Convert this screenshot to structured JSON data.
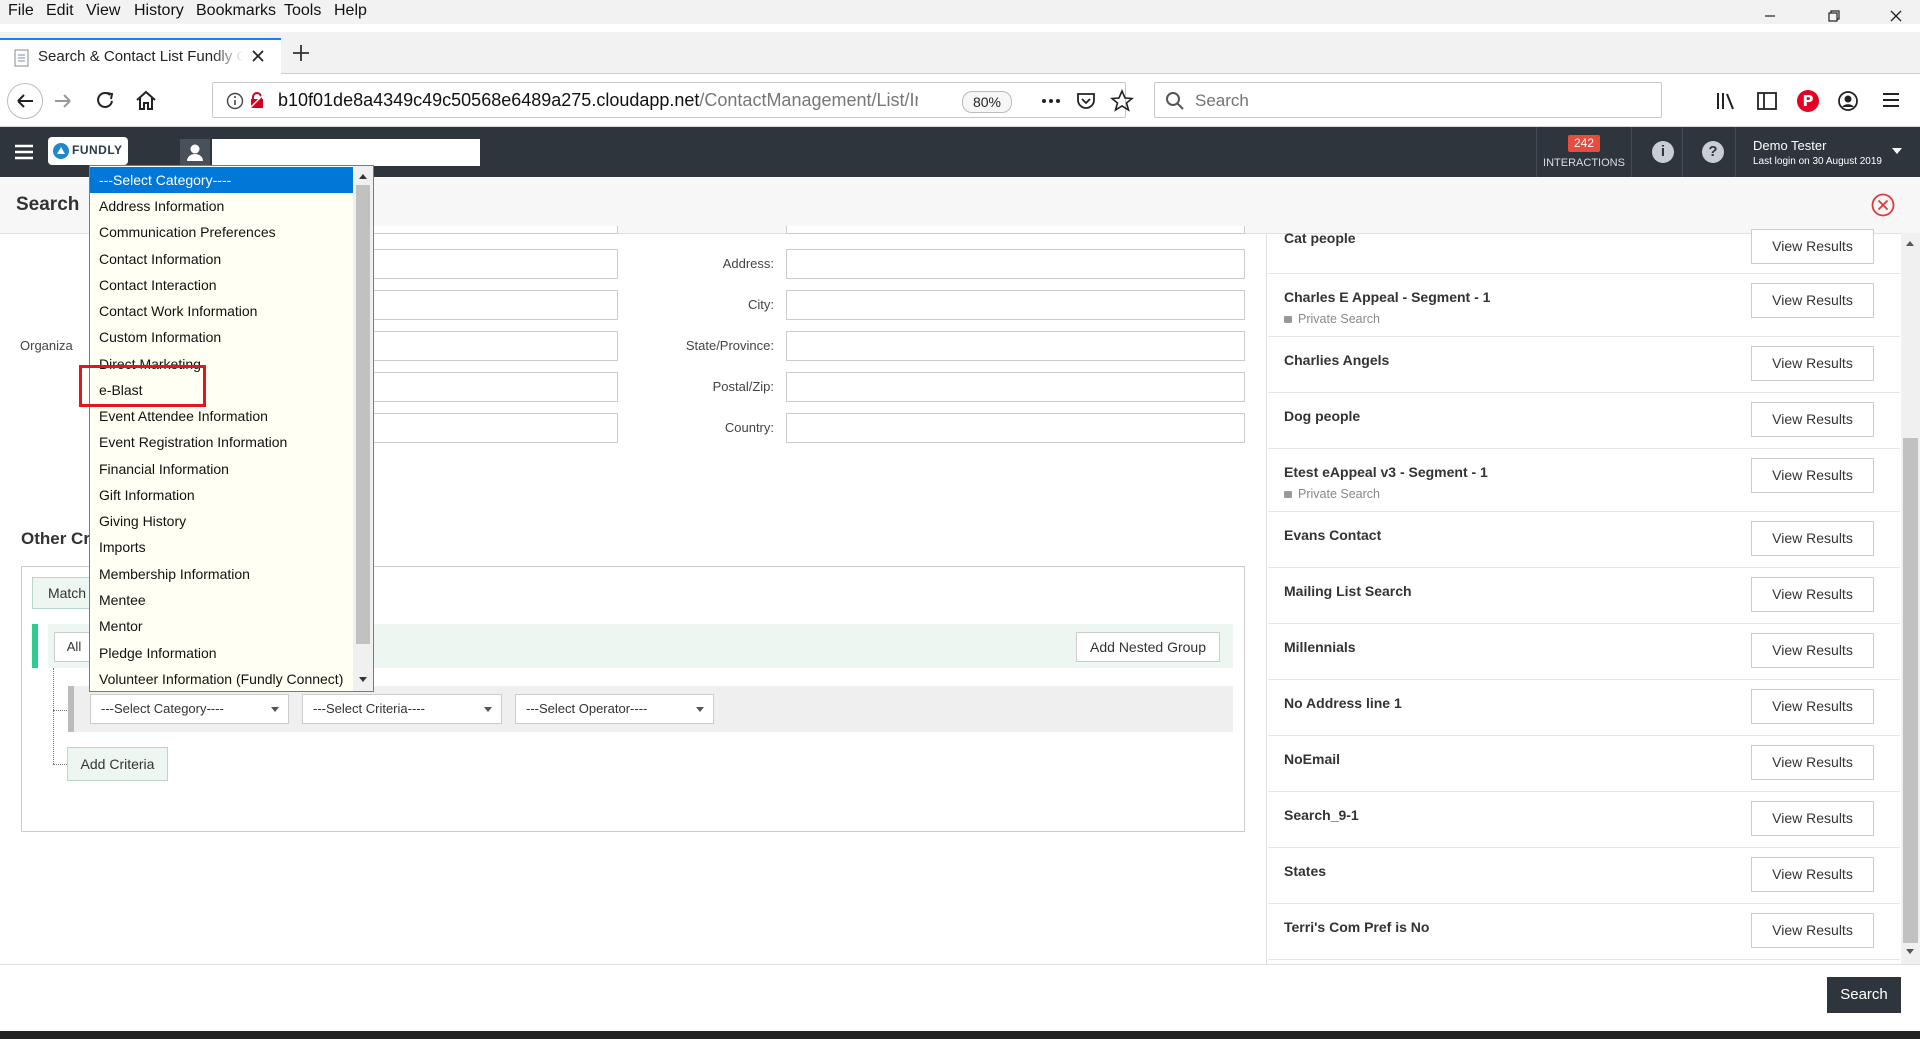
{
  "browser": {
    "menu": [
      "File",
      "Edit",
      "View",
      "History",
      "Bookmarks",
      "Tools",
      "Help"
    ],
    "tab_title": "Search & Contact List Fundly CRM",
    "url_main": "b10f01de8a4349c49c50568e6489a275.cloudapp.net",
    "url_path": "/ContactManagement/List/Index",
    "zoom": "80%",
    "search_placeholder": "Search"
  },
  "app": {
    "logo_text": "FUNDLY",
    "interactions_count": "242",
    "interactions_label": "INTERACTIONS",
    "user_name": "Demo Tester",
    "last_login": "Last login on 30 August 2019"
  },
  "page": {
    "title": "Search",
    "labels": {
      "organization": "Organiza",
      "address": "Address:",
      "city": "City:",
      "state": "State/Province:",
      "postal": "Postal/Zip:",
      "country": "Country:"
    },
    "other_criteria": "Other Cr",
    "match": "Match",
    "all": "All",
    "add_nested_group": "Add Nested Group",
    "select_category": "---Select Category----",
    "select_criteria": "---Select Criteria----",
    "select_operator": "---Select Operator----",
    "add_criteria": "Add Criteria",
    "search_button": "Search"
  },
  "saved_searches": [
    {
      "name": "Cat people",
      "private": ""
    },
    {
      "name": "Charles E Appeal - Segment - 1",
      "private": "Private Search"
    },
    {
      "name": "Charlies Angels",
      "private": ""
    },
    {
      "name": "Dog people",
      "private": ""
    },
    {
      "name": "Etest eAppeal v3 - Segment - 1",
      "private": "Private Search"
    },
    {
      "name": "Evans Contact",
      "private": ""
    },
    {
      "name": "Mailing List Search",
      "private": ""
    },
    {
      "name": "Millennials",
      "private": ""
    },
    {
      "name": "No Address line 1",
      "private": ""
    },
    {
      "name": "NoEmail",
      "private": ""
    },
    {
      "name": "Search_9-1",
      "private": ""
    },
    {
      "name": "States",
      "private": ""
    },
    {
      "name": "Terri's Com Pref is No",
      "private": ""
    }
  ],
  "view_results_label": "View Results",
  "dropdown": {
    "options": [
      "---Select Category----",
      "Address Information",
      "Communication Preferences",
      "Contact Information",
      "Contact Interaction",
      "Contact Work Information",
      "Custom Information",
      "Direct Marketing",
      "e-Blast",
      "Event Attendee Information",
      "Event Registration Information",
      "Financial Information",
      "Gift Information",
      "Giving History",
      "Imports",
      "Membership Information",
      "Mentee",
      "Mentor",
      "Pledge Information",
      "Volunteer Information (Fundly Connect)"
    ],
    "selected_index": 0,
    "highlighted_index": 8,
    "highlight_color": "#e0181b"
  },
  "colors": {
    "header_bg": "#2f353d",
    "selection_blue": "#0078d7",
    "badge_red": "#e74c3c",
    "group_accent": "#2ecc8f"
  }
}
